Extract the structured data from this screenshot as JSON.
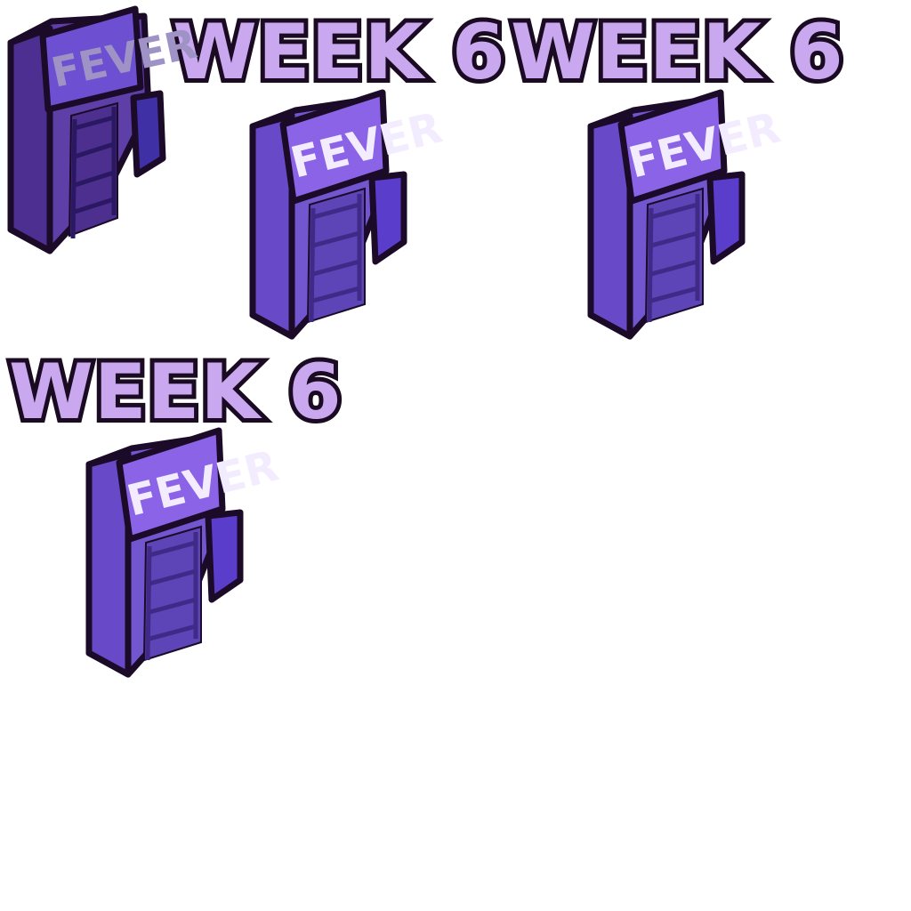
{
  "titles": {
    "top_middle": "WEEK 6",
    "top_right": "WEEK 6",
    "middle_left": "WEEK 6"
  },
  "signs": {
    "sign_1": "FEVER",
    "sign_2": "FEVER",
    "sign_3": "FEVER",
    "sign_4": "FEVER"
  },
  "colors": {
    "title_fill": "#c9a8ef",
    "title_outline": "#1a0b22",
    "building_front": "#7e5ed6",
    "building_side": "#5f43c2",
    "building_dark": "#3c1f6e",
    "sign_panel": "#8a63e6",
    "sign_text": "#f3ecff",
    "ladder": "#3f2a87",
    "outline": "#1b0b28"
  },
  "icons": {
    "building": "fever-arcade-building-icon"
  }
}
